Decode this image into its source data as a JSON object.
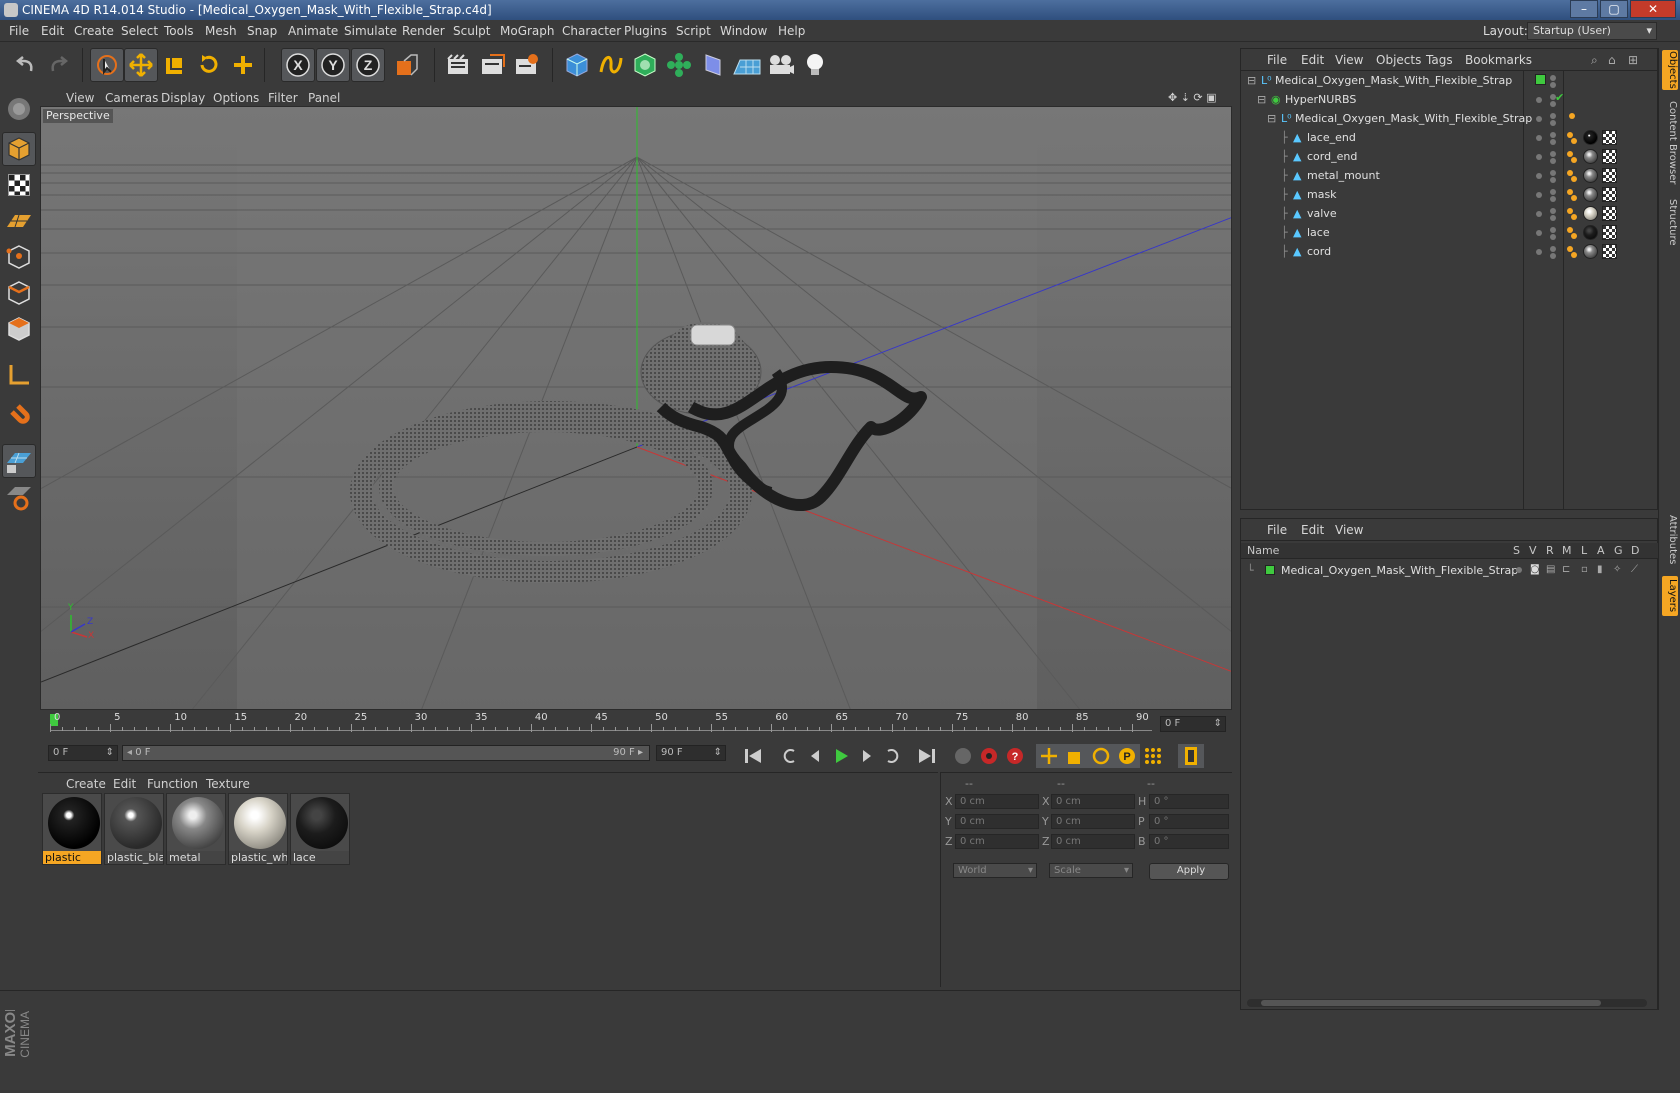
{
  "window": {
    "title": "CINEMA 4D R14.014 Studio - [Medical_Oxygen_Mask_With_Flexible_Strap.c4d]",
    "minimize": "–",
    "maximize": "▢",
    "close": "✕"
  },
  "menubar": {
    "items": [
      "File",
      "Edit",
      "Create",
      "Select",
      "Tools",
      "Mesh",
      "Snap",
      "Animate",
      "Simulate",
      "Render",
      "Sculpt",
      "MoGraph",
      "Character",
      "Plugins",
      "Script",
      "Window",
      "Help"
    ],
    "layout_label": "Layout:",
    "layout_value": "Startup (User)"
  },
  "toolbar": {
    "icons": [
      "undo-icon",
      "redo-icon",
      "live-selection-icon",
      "move-icon",
      "scale-icon",
      "rotate-icon",
      "add-icon",
      "x-axis-lock-icon",
      "y-axis-lock-icon",
      "z-axis-lock-icon",
      "coordinate-system-icon",
      "render-view-icon",
      "render-picture-viewer-icon",
      "render-settings-icon",
      "cube-icon",
      "spline-icon",
      "nurbs-icon",
      "array-icon",
      "deformer-icon",
      "floor-icon",
      "camera-icon",
      "light-icon"
    ]
  },
  "left_tools": {
    "icons": [
      "make-editable-icon",
      "model-mode-icon",
      "texture-mode-icon",
      "workplane-mode-icon",
      "points-mode-icon",
      "edges-mode-icon",
      "polygons-mode-icon",
      "axis-mode-icon",
      "magnet-icon",
      "grid-lock-icon",
      "snap-icon"
    ],
    "brand_top": "MAXON",
    "brand_bottom": "CINEMA 4D"
  },
  "viewport": {
    "menu": [
      "View",
      "Cameras",
      "Display",
      "Options",
      "Filter",
      "Panel"
    ],
    "label": "Perspective",
    "axis_x": "X",
    "axis_y": "Y",
    "axis_z": "Z"
  },
  "timeline": {
    "ticks": [
      "0",
      "5",
      "10",
      "15",
      "20",
      "25",
      "30",
      "35",
      "40",
      "45",
      "50",
      "55",
      "60",
      "65",
      "70",
      "75",
      "80",
      "85",
      "90"
    ],
    "current_frame": "0 F"
  },
  "playbar": {
    "start_field": "0 F",
    "range_start": "0 F",
    "range_end": "90 F",
    "end_field": "90 F"
  },
  "materials": {
    "menu": [
      "Create",
      "Edit",
      "Function",
      "Texture"
    ],
    "items": [
      {
        "name": "plastic",
        "selected": true
      },
      {
        "name": "plastic_bla",
        "selected": false
      },
      {
        "name": "metal",
        "selected": false
      },
      {
        "name": "plastic_whi",
        "selected": false
      },
      {
        "name": "lace",
        "selected": false
      }
    ]
  },
  "coordinates": {
    "headers": [
      "--",
      "--",
      "--"
    ],
    "rows": [
      {
        "l1": "X",
        "v1": "0 cm",
        "l2": "X",
        "v2": "0 cm",
        "l3": "H",
        "v3": "0 °"
      },
      {
        "l1": "Y",
        "v1": "0 cm",
        "l2": "Y",
        "v2": "0 cm",
        "l3": "P",
        "v3": "0 °"
      },
      {
        "l1": "Z",
        "v1": "0 cm",
        "l2": "Z",
        "v2": "0 cm",
        "l3": "B",
        "v3": "0 °"
      }
    ],
    "world": "World",
    "scale": "Scale",
    "apply": "Apply"
  },
  "objects_panel": {
    "menu": [
      "File",
      "Edit",
      "View",
      "Objects",
      "Tags",
      "Bookmarks"
    ],
    "rows": [
      {
        "name": "Medical_Oxygen_Mask_With_Flexible_Strap",
        "depth": 0
      },
      {
        "name": "HyperNURBS",
        "depth": 1
      },
      {
        "name": "Medical_Oxygen_Mask_With_Flexible_Strap",
        "depth": 2
      },
      {
        "name": "lace_end",
        "depth": 3
      },
      {
        "name": "cord_end",
        "depth": 3
      },
      {
        "name": "metal_mount",
        "depth": 3
      },
      {
        "name": "mask",
        "depth": 3
      },
      {
        "name": "valve",
        "depth": 3
      },
      {
        "name": "lace",
        "depth": 3
      },
      {
        "name": "cord",
        "depth": 3
      }
    ]
  },
  "layers_panel": {
    "menu": [
      "File",
      "Edit",
      "View"
    ],
    "columns": [
      "Name",
      "S",
      "V",
      "R",
      "M",
      "L",
      "A",
      "G",
      "D"
    ],
    "row": "Medical_Oxygen_Mask_With_Flexible_Strap"
  },
  "side_tabs": {
    "top": [
      "Objects",
      "Content Browser",
      "Structure"
    ],
    "bottom": [
      "Attributes",
      "Layers"
    ]
  },
  "colors": {
    "accent_orange": "#f5a623",
    "layer_green": "#3fc93f",
    "title_blue": "#3e5f8f"
  }
}
